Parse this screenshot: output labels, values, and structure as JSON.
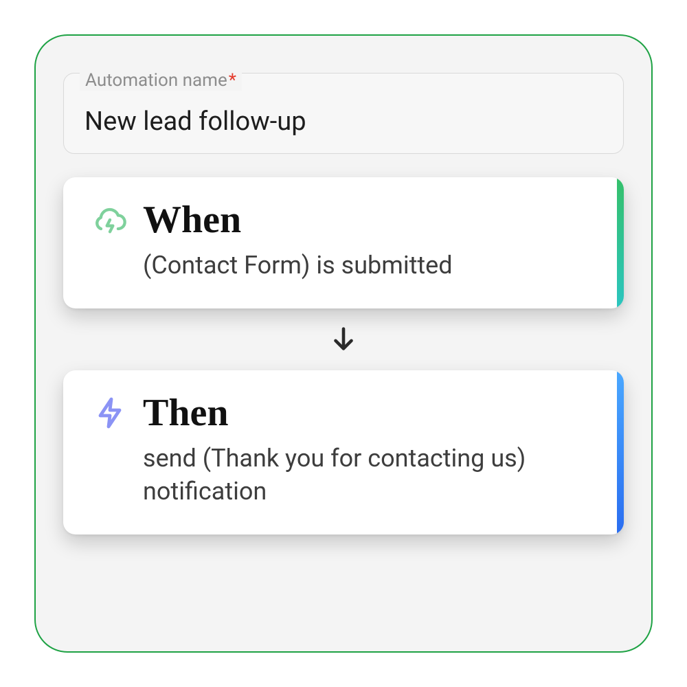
{
  "field": {
    "label": "Automation name",
    "required_marker": "*",
    "value": "New lead follow-up"
  },
  "steps": {
    "when": {
      "title": "When",
      "description": "(Contact Form) is submitted"
    },
    "then": {
      "title": "Then",
      "description": "send (Thank you for contacting us) notification"
    }
  }
}
